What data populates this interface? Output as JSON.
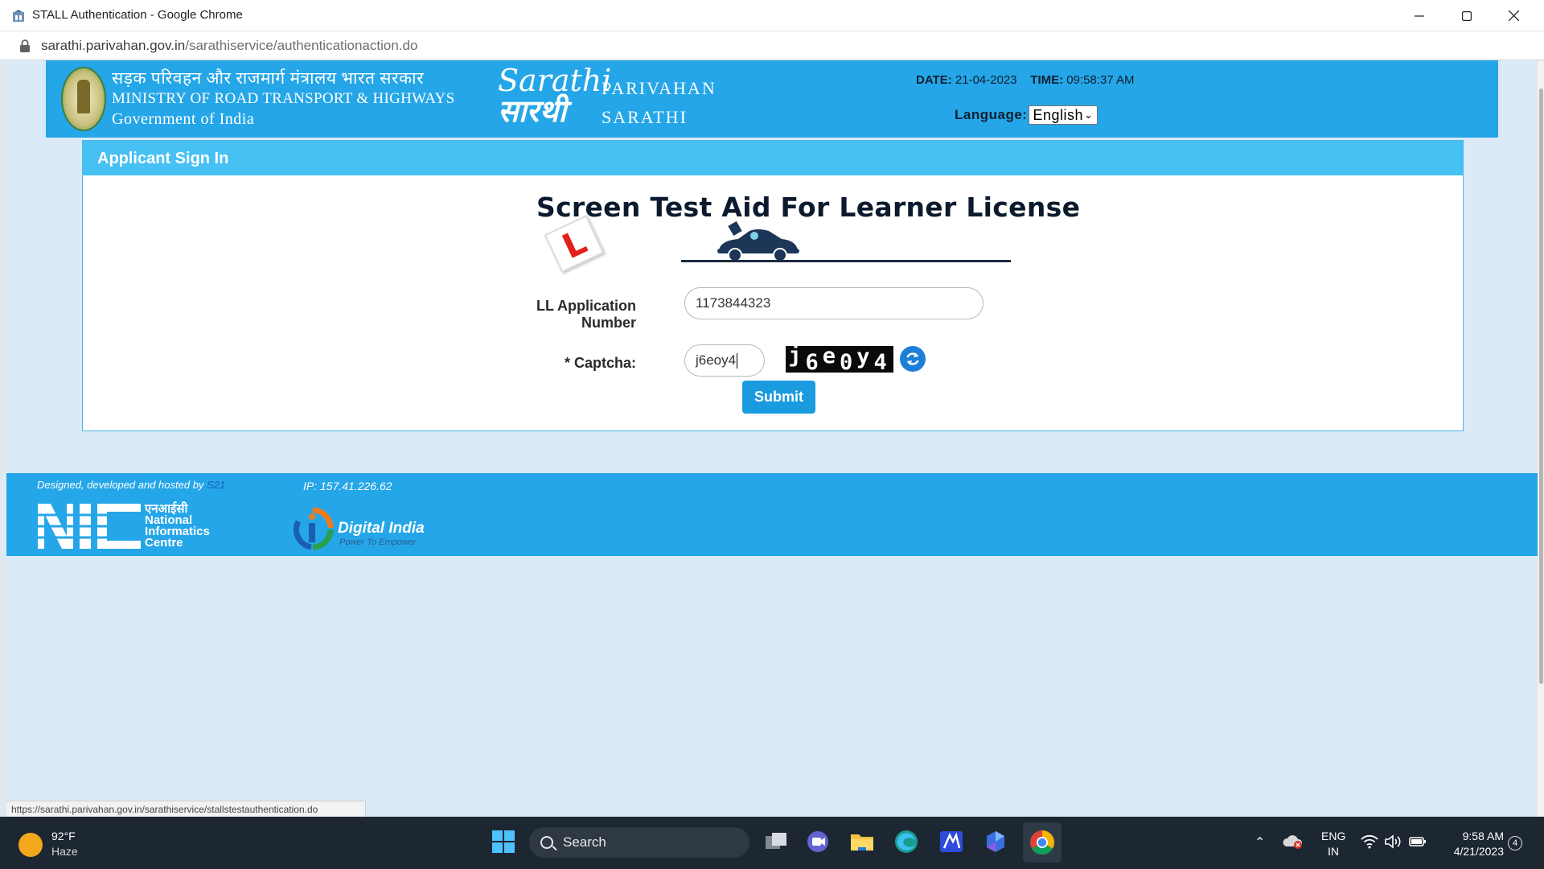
{
  "browser": {
    "window_title": "STALL Authentication - Google Chrome",
    "url_domain": "sarathi.parivahan.gov.in",
    "url_path": "/sarathiservice/authenticationaction.do",
    "status_url": "https://sarathi.parivahan.gov.in/sarathiservice/stallstestauthentication.do"
  },
  "header": {
    "hindi_ministry": "सड़क परिवहन और राजमार्ग मंत्रालय भारत सरकार",
    "ministry": "MINISTRY OF ROAD TRANSPORT & HIGHWAYS",
    "government": "Government of India",
    "logo_line1": "Sarathi",
    "logo_line2": "सारथी",
    "brand_line1": "PARIVAHAN",
    "brand_line2": "SARATHI",
    "date_label": "DATE:",
    "date_value": "21-04-2023",
    "time_label": "TIME:",
    "time_value": "09:58:37 AM",
    "language_label": "Language:",
    "language_selected": "English"
  },
  "panel": {
    "heading": "Applicant Sign In",
    "title": "Screen Test Aid For Learner License",
    "l_plate": "L",
    "app_number_label": "LL Application Number",
    "app_number_value": "1173844323",
    "captcha_label": "* Captcha:",
    "captcha_value": "j6eoy4",
    "captcha_chars": [
      "j",
      "6",
      "e",
      "0",
      "y",
      "4"
    ],
    "submit_label": "Submit"
  },
  "footer": {
    "credit_prefix": "Designed, developed and hosted by",
    "credit_link": "S21",
    "ip_label": "IP:",
    "ip_value": "157.41.226.62",
    "nic_hindi": "एनआईसी",
    "nic_line1": "National",
    "nic_line2": "Informatics",
    "nic_line3": "Centre",
    "digital_india": "Digital India",
    "digital_india_tagline": "Power To Empower"
  },
  "taskbar": {
    "temperature": "92°F",
    "condition": "Haze",
    "search_label": "Search",
    "lang_line1": "ENG",
    "lang_line2": "IN",
    "time": "9:58 AM",
    "date": "4/21/2023",
    "notification_count": "4"
  },
  "colors": {
    "header_blue": "#25a6e8",
    "panel_head": "#47c0f4",
    "submit": "#1a9be0",
    "page_bg": "#daeaf6"
  }
}
